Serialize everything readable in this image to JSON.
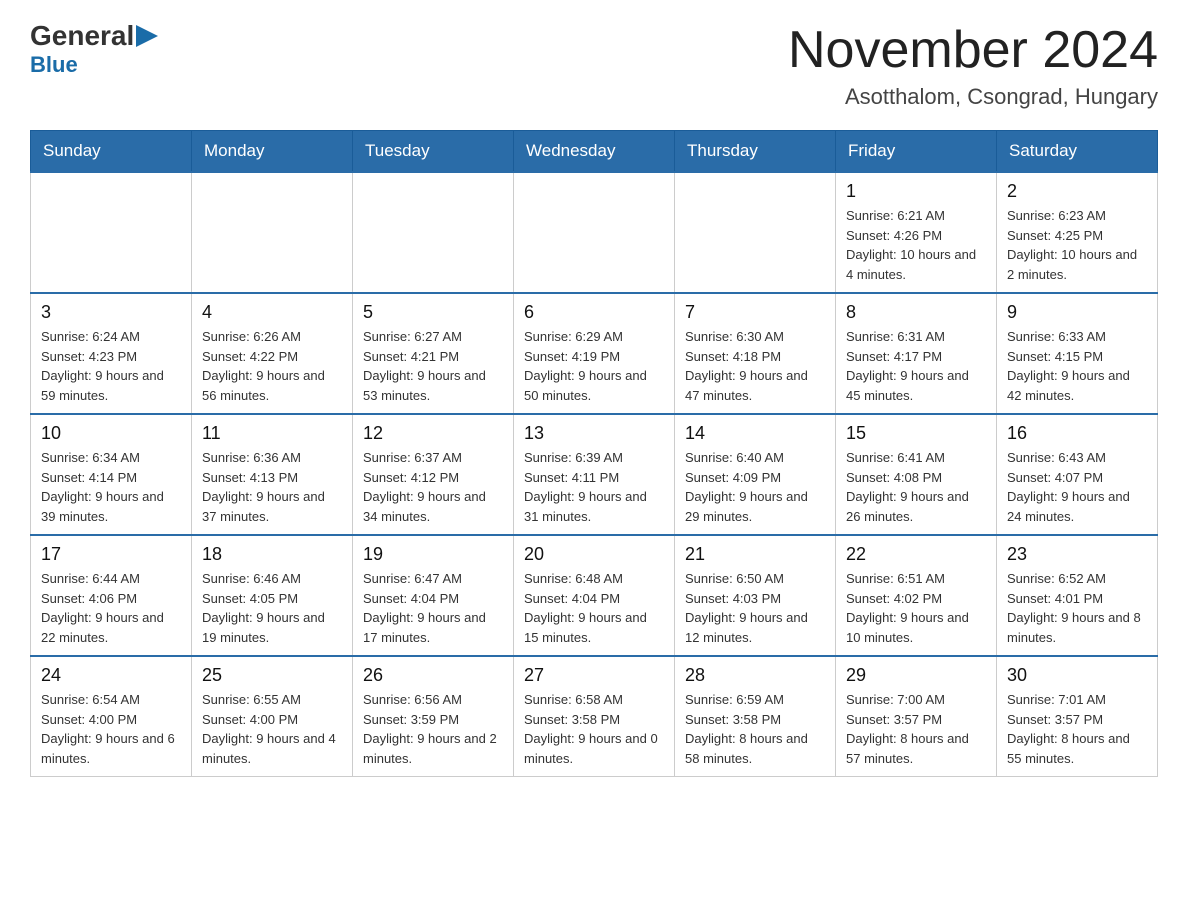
{
  "header": {
    "logo_general": "General",
    "logo_blue": "Blue",
    "month_title": "November 2024",
    "location": "Asotthalom, Csongrad, Hungary"
  },
  "weekdays": [
    "Sunday",
    "Monday",
    "Tuesday",
    "Wednesday",
    "Thursday",
    "Friday",
    "Saturday"
  ],
  "weeks": [
    [
      {
        "day": "",
        "info": ""
      },
      {
        "day": "",
        "info": ""
      },
      {
        "day": "",
        "info": ""
      },
      {
        "day": "",
        "info": ""
      },
      {
        "day": "",
        "info": ""
      },
      {
        "day": "1",
        "info": "Sunrise: 6:21 AM\nSunset: 4:26 PM\nDaylight: 10 hours and 4 minutes."
      },
      {
        "day": "2",
        "info": "Sunrise: 6:23 AM\nSunset: 4:25 PM\nDaylight: 10 hours and 2 minutes."
      }
    ],
    [
      {
        "day": "3",
        "info": "Sunrise: 6:24 AM\nSunset: 4:23 PM\nDaylight: 9 hours and 59 minutes."
      },
      {
        "day": "4",
        "info": "Sunrise: 6:26 AM\nSunset: 4:22 PM\nDaylight: 9 hours and 56 minutes."
      },
      {
        "day": "5",
        "info": "Sunrise: 6:27 AM\nSunset: 4:21 PM\nDaylight: 9 hours and 53 minutes."
      },
      {
        "day": "6",
        "info": "Sunrise: 6:29 AM\nSunset: 4:19 PM\nDaylight: 9 hours and 50 minutes."
      },
      {
        "day": "7",
        "info": "Sunrise: 6:30 AM\nSunset: 4:18 PM\nDaylight: 9 hours and 47 minutes."
      },
      {
        "day": "8",
        "info": "Sunrise: 6:31 AM\nSunset: 4:17 PM\nDaylight: 9 hours and 45 minutes."
      },
      {
        "day": "9",
        "info": "Sunrise: 6:33 AM\nSunset: 4:15 PM\nDaylight: 9 hours and 42 minutes."
      }
    ],
    [
      {
        "day": "10",
        "info": "Sunrise: 6:34 AM\nSunset: 4:14 PM\nDaylight: 9 hours and 39 minutes."
      },
      {
        "day": "11",
        "info": "Sunrise: 6:36 AM\nSunset: 4:13 PM\nDaylight: 9 hours and 37 minutes."
      },
      {
        "day": "12",
        "info": "Sunrise: 6:37 AM\nSunset: 4:12 PM\nDaylight: 9 hours and 34 minutes."
      },
      {
        "day": "13",
        "info": "Sunrise: 6:39 AM\nSunset: 4:11 PM\nDaylight: 9 hours and 31 minutes."
      },
      {
        "day": "14",
        "info": "Sunrise: 6:40 AM\nSunset: 4:09 PM\nDaylight: 9 hours and 29 minutes."
      },
      {
        "day": "15",
        "info": "Sunrise: 6:41 AM\nSunset: 4:08 PM\nDaylight: 9 hours and 26 minutes."
      },
      {
        "day": "16",
        "info": "Sunrise: 6:43 AM\nSunset: 4:07 PM\nDaylight: 9 hours and 24 minutes."
      }
    ],
    [
      {
        "day": "17",
        "info": "Sunrise: 6:44 AM\nSunset: 4:06 PM\nDaylight: 9 hours and 22 minutes."
      },
      {
        "day": "18",
        "info": "Sunrise: 6:46 AM\nSunset: 4:05 PM\nDaylight: 9 hours and 19 minutes."
      },
      {
        "day": "19",
        "info": "Sunrise: 6:47 AM\nSunset: 4:04 PM\nDaylight: 9 hours and 17 minutes."
      },
      {
        "day": "20",
        "info": "Sunrise: 6:48 AM\nSunset: 4:04 PM\nDaylight: 9 hours and 15 minutes."
      },
      {
        "day": "21",
        "info": "Sunrise: 6:50 AM\nSunset: 4:03 PM\nDaylight: 9 hours and 12 minutes."
      },
      {
        "day": "22",
        "info": "Sunrise: 6:51 AM\nSunset: 4:02 PM\nDaylight: 9 hours and 10 minutes."
      },
      {
        "day": "23",
        "info": "Sunrise: 6:52 AM\nSunset: 4:01 PM\nDaylight: 9 hours and 8 minutes."
      }
    ],
    [
      {
        "day": "24",
        "info": "Sunrise: 6:54 AM\nSunset: 4:00 PM\nDaylight: 9 hours and 6 minutes."
      },
      {
        "day": "25",
        "info": "Sunrise: 6:55 AM\nSunset: 4:00 PM\nDaylight: 9 hours and 4 minutes."
      },
      {
        "day": "26",
        "info": "Sunrise: 6:56 AM\nSunset: 3:59 PM\nDaylight: 9 hours and 2 minutes."
      },
      {
        "day": "27",
        "info": "Sunrise: 6:58 AM\nSunset: 3:58 PM\nDaylight: 9 hours and 0 minutes."
      },
      {
        "day": "28",
        "info": "Sunrise: 6:59 AM\nSunset: 3:58 PM\nDaylight: 8 hours and 58 minutes."
      },
      {
        "day": "29",
        "info": "Sunrise: 7:00 AM\nSunset: 3:57 PM\nDaylight: 8 hours and 57 minutes."
      },
      {
        "day": "30",
        "info": "Sunrise: 7:01 AM\nSunset: 3:57 PM\nDaylight: 8 hours and 55 minutes."
      }
    ]
  ]
}
